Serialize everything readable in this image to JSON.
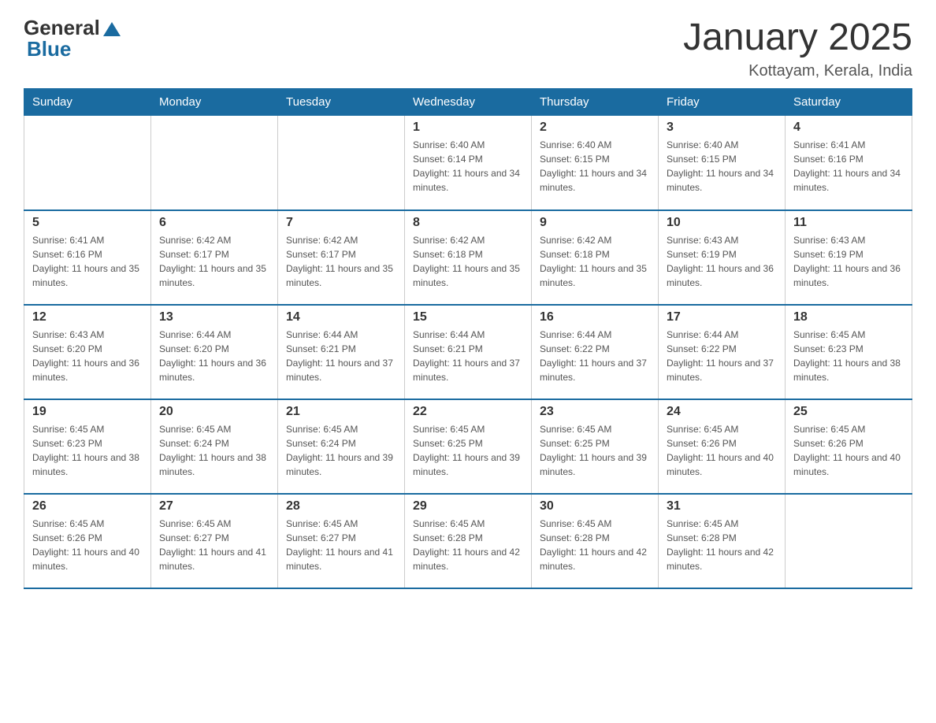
{
  "header": {
    "logo_general": "General",
    "logo_blue": "Blue",
    "month_title": "January 2025",
    "location": "Kottayam, Kerala, India"
  },
  "days_of_week": [
    "Sunday",
    "Monday",
    "Tuesday",
    "Wednesday",
    "Thursday",
    "Friday",
    "Saturday"
  ],
  "weeks": [
    [
      {
        "day": "",
        "info": ""
      },
      {
        "day": "",
        "info": ""
      },
      {
        "day": "",
        "info": ""
      },
      {
        "day": "1",
        "info": "Sunrise: 6:40 AM\nSunset: 6:14 PM\nDaylight: 11 hours and 34 minutes."
      },
      {
        "day": "2",
        "info": "Sunrise: 6:40 AM\nSunset: 6:15 PM\nDaylight: 11 hours and 34 minutes."
      },
      {
        "day": "3",
        "info": "Sunrise: 6:40 AM\nSunset: 6:15 PM\nDaylight: 11 hours and 34 minutes."
      },
      {
        "day": "4",
        "info": "Sunrise: 6:41 AM\nSunset: 6:16 PM\nDaylight: 11 hours and 34 minutes."
      }
    ],
    [
      {
        "day": "5",
        "info": "Sunrise: 6:41 AM\nSunset: 6:16 PM\nDaylight: 11 hours and 35 minutes."
      },
      {
        "day": "6",
        "info": "Sunrise: 6:42 AM\nSunset: 6:17 PM\nDaylight: 11 hours and 35 minutes."
      },
      {
        "day": "7",
        "info": "Sunrise: 6:42 AM\nSunset: 6:17 PM\nDaylight: 11 hours and 35 minutes."
      },
      {
        "day": "8",
        "info": "Sunrise: 6:42 AM\nSunset: 6:18 PM\nDaylight: 11 hours and 35 minutes."
      },
      {
        "day": "9",
        "info": "Sunrise: 6:42 AM\nSunset: 6:18 PM\nDaylight: 11 hours and 35 minutes."
      },
      {
        "day": "10",
        "info": "Sunrise: 6:43 AM\nSunset: 6:19 PM\nDaylight: 11 hours and 36 minutes."
      },
      {
        "day": "11",
        "info": "Sunrise: 6:43 AM\nSunset: 6:19 PM\nDaylight: 11 hours and 36 minutes."
      }
    ],
    [
      {
        "day": "12",
        "info": "Sunrise: 6:43 AM\nSunset: 6:20 PM\nDaylight: 11 hours and 36 minutes."
      },
      {
        "day": "13",
        "info": "Sunrise: 6:44 AM\nSunset: 6:20 PM\nDaylight: 11 hours and 36 minutes."
      },
      {
        "day": "14",
        "info": "Sunrise: 6:44 AM\nSunset: 6:21 PM\nDaylight: 11 hours and 37 minutes."
      },
      {
        "day": "15",
        "info": "Sunrise: 6:44 AM\nSunset: 6:21 PM\nDaylight: 11 hours and 37 minutes."
      },
      {
        "day": "16",
        "info": "Sunrise: 6:44 AM\nSunset: 6:22 PM\nDaylight: 11 hours and 37 minutes."
      },
      {
        "day": "17",
        "info": "Sunrise: 6:44 AM\nSunset: 6:22 PM\nDaylight: 11 hours and 37 minutes."
      },
      {
        "day": "18",
        "info": "Sunrise: 6:45 AM\nSunset: 6:23 PM\nDaylight: 11 hours and 38 minutes."
      }
    ],
    [
      {
        "day": "19",
        "info": "Sunrise: 6:45 AM\nSunset: 6:23 PM\nDaylight: 11 hours and 38 minutes."
      },
      {
        "day": "20",
        "info": "Sunrise: 6:45 AM\nSunset: 6:24 PM\nDaylight: 11 hours and 38 minutes."
      },
      {
        "day": "21",
        "info": "Sunrise: 6:45 AM\nSunset: 6:24 PM\nDaylight: 11 hours and 39 minutes."
      },
      {
        "day": "22",
        "info": "Sunrise: 6:45 AM\nSunset: 6:25 PM\nDaylight: 11 hours and 39 minutes."
      },
      {
        "day": "23",
        "info": "Sunrise: 6:45 AM\nSunset: 6:25 PM\nDaylight: 11 hours and 39 minutes."
      },
      {
        "day": "24",
        "info": "Sunrise: 6:45 AM\nSunset: 6:26 PM\nDaylight: 11 hours and 40 minutes."
      },
      {
        "day": "25",
        "info": "Sunrise: 6:45 AM\nSunset: 6:26 PM\nDaylight: 11 hours and 40 minutes."
      }
    ],
    [
      {
        "day": "26",
        "info": "Sunrise: 6:45 AM\nSunset: 6:26 PM\nDaylight: 11 hours and 40 minutes."
      },
      {
        "day": "27",
        "info": "Sunrise: 6:45 AM\nSunset: 6:27 PM\nDaylight: 11 hours and 41 minutes."
      },
      {
        "day": "28",
        "info": "Sunrise: 6:45 AM\nSunset: 6:27 PM\nDaylight: 11 hours and 41 minutes."
      },
      {
        "day": "29",
        "info": "Sunrise: 6:45 AM\nSunset: 6:28 PM\nDaylight: 11 hours and 42 minutes."
      },
      {
        "day": "30",
        "info": "Sunrise: 6:45 AM\nSunset: 6:28 PM\nDaylight: 11 hours and 42 minutes."
      },
      {
        "day": "31",
        "info": "Sunrise: 6:45 AM\nSunset: 6:28 PM\nDaylight: 11 hours and 42 minutes."
      },
      {
        "day": "",
        "info": ""
      }
    ]
  ]
}
